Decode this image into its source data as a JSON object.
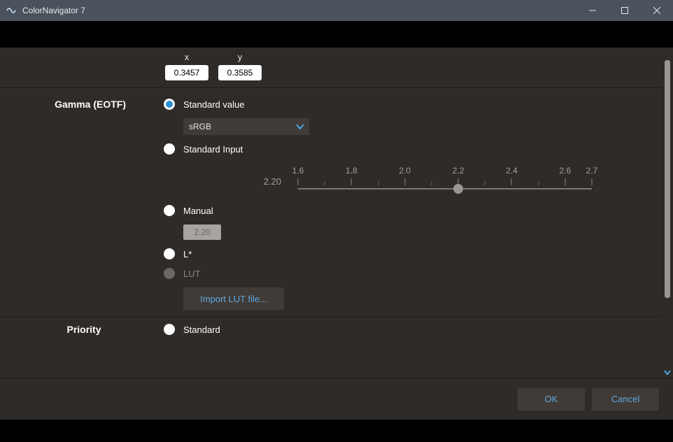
{
  "window": {
    "title": "ColorNavigator 7"
  },
  "coords": {
    "xlabel": "x",
    "ylabel": "y",
    "x": "0.3457",
    "y": "0.3585"
  },
  "gamma": {
    "section_label": "Gamma (EOTF)",
    "options": {
      "standard_value": "Standard value",
      "standard_input": "Standard Input",
      "manual": "Manual",
      "lstar": "L*",
      "lut": "LUT"
    },
    "standard_combo": "sRGB",
    "slider": {
      "min": 1.6,
      "max": 2.7,
      "step_major": 0.2,
      "tick_labels": [
        "1.6",
        "1.8",
        "2.0",
        "2.2",
        "2.4",
        "2.6",
        "2.7"
      ],
      "value": 2.2,
      "readout": "2.20"
    },
    "manual_value": "2.20",
    "import_lut": "Import LUT file..."
  },
  "priority": {
    "section_label": "Priority",
    "option_standard": "Standard"
  },
  "footer": {
    "ok": "OK",
    "cancel": "Cancel"
  }
}
